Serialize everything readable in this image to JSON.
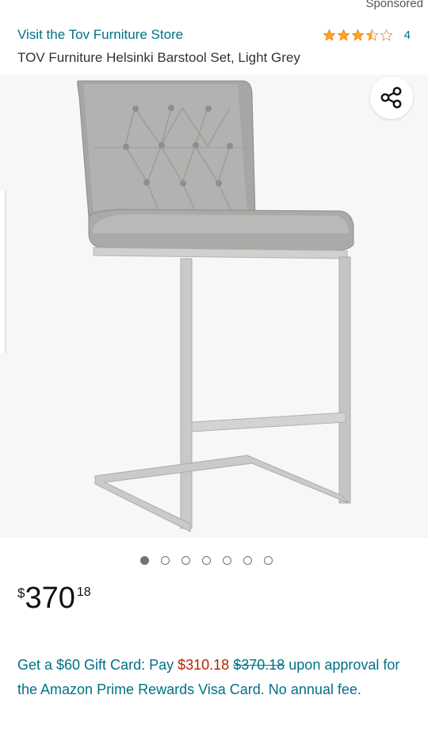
{
  "header": {
    "sponsored_label": "Sponsored",
    "store_link": "Visit the Tov Furniture Store",
    "rating_stars": 3.5,
    "rating_count": "4",
    "product_title": "TOV Furniture Helsinki Barstool Set, Light Grey"
  },
  "gallery": {
    "image_description": "grey tufted leather barstool with brushed steel cantilever frame",
    "image_count": 7,
    "active_index": 0,
    "share_icon": "share-icon"
  },
  "price": {
    "symbol": "$",
    "whole": "370",
    "fraction": "18"
  },
  "promo": {
    "part1": "Get a $60 Gift Card: Pay ",
    "pay_amount": "$310.18",
    "space": " ",
    "strike_amount": "$370.18",
    "part2": " upon approval for the Amazon Prime Rewards Visa Card. No annual fee."
  },
  "colors": {
    "link": "#007185",
    "star": "#FFA41C",
    "deal_price": "#B12704"
  }
}
